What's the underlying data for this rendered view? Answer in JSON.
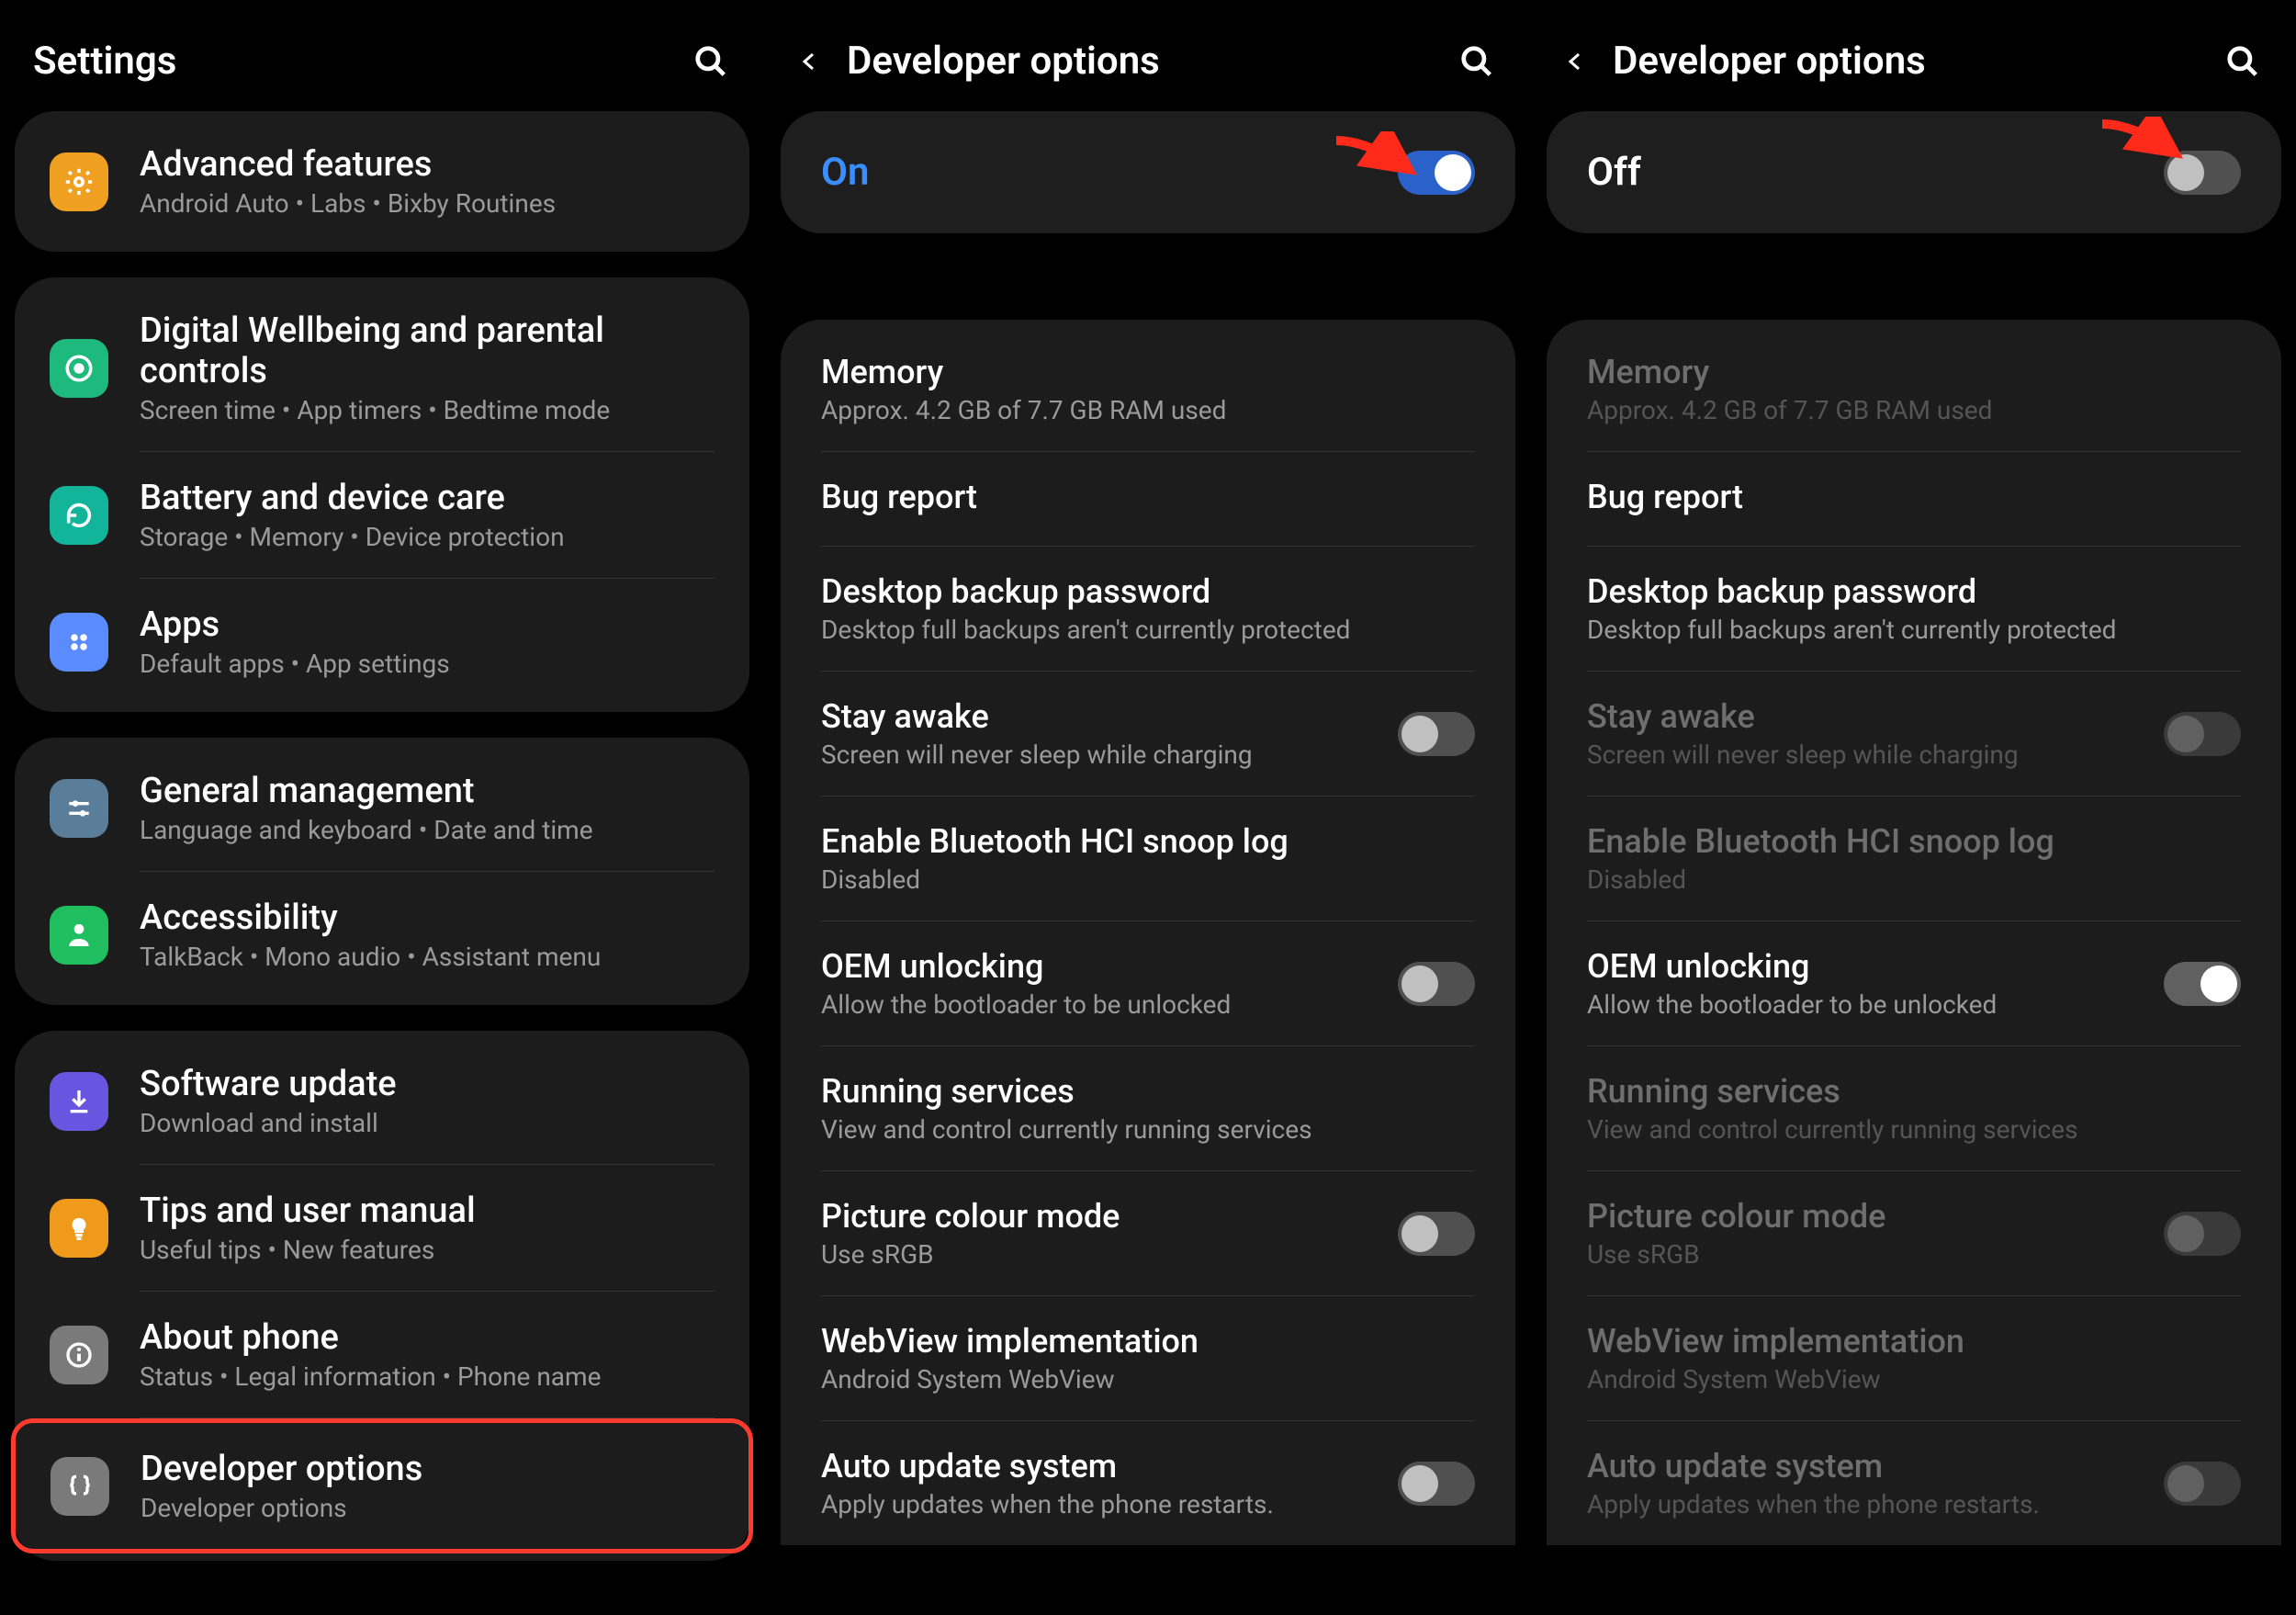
{
  "panel1": {
    "title": "Settings",
    "groups": [
      {
        "items": [
          {
            "iconColor": "#f0a020",
            "glyph": "gear",
            "primary": "Advanced features",
            "secondary": "Android Auto  •  Labs  •  Bixby Routines"
          }
        ]
      },
      {
        "items": [
          {
            "iconColor": "#1db97d",
            "glyph": "circle-target",
            "primary": "Digital Wellbeing and parental controls",
            "secondary": "Screen time  •  App timers  •  Bedtime mode"
          },
          {
            "iconColor": "#12b59a",
            "glyph": "refresh",
            "primary": "Battery and device care",
            "secondary": "Storage  •  Memory  •  Device protection"
          },
          {
            "iconColor": "#5a8cff",
            "glyph": "grid4",
            "primary": "Apps",
            "secondary": "Default apps  •  App settings"
          }
        ]
      },
      {
        "items": [
          {
            "iconColor": "#5a7d9a",
            "glyph": "sliders",
            "primary": "General management",
            "secondary": "Language and keyboard  •  Date and time"
          },
          {
            "iconColor": "#1fbf5f",
            "glyph": "person",
            "primary": "Accessibility",
            "secondary": "TalkBack  •  Mono audio  •  Assistant menu"
          }
        ]
      },
      {
        "items": [
          {
            "iconColor": "#6a55e0",
            "glyph": "download",
            "primary": "Software update",
            "secondary": "Download and install"
          },
          {
            "iconColor": "#f09a1c",
            "glyph": "bulb",
            "primary": "Tips and user manual",
            "secondary": "Useful tips  •  New features"
          },
          {
            "iconColor": "#7a7a7a",
            "glyph": "info",
            "primary": "About phone",
            "secondary": "Status  •  Legal information  •  Phone name"
          },
          {
            "iconColor": "#7a7a7a",
            "glyph": "braces",
            "primary": "Developer options",
            "secondary": "Developer options",
            "highlight": true
          }
        ]
      }
    ]
  },
  "panel2": {
    "title": "Developer options",
    "master": {
      "label": "On",
      "state": "on"
    },
    "items": [
      {
        "primary": "Memory",
        "secondary": "Approx. 4.2 GB of 7.7 GB RAM used"
      },
      {
        "primary": "Bug report"
      },
      {
        "primary": "Desktop backup password",
        "secondary": "Desktop full backups aren't currently protected"
      },
      {
        "primary": "Stay awake",
        "secondary": "Screen will never sleep while charging",
        "switch": "off"
      },
      {
        "primary": "Enable Bluetooth HCI snoop log",
        "secondary": "Disabled"
      },
      {
        "primary": "OEM unlocking",
        "secondary": "Allow the bootloader to be unlocked",
        "switch": "off"
      },
      {
        "primary": "Running services",
        "secondary": "View and control currently running services"
      },
      {
        "primary": "Picture colour mode",
        "secondary": "Use sRGB",
        "switch": "off"
      },
      {
        "primary": "WebView implementation",
        "secondary": "Android System WebView"
      },
      {
        "primary": "Auto update system",
        "secondary": "Apply updates when the phone restarts.",
        "switch": "off-peek"
      }
    ]
  },
  "panel3": {
    "title": "Developer options",
    "master": {
      "label": "Off",
      "state": "off"
    },
    "items": [
      {
        "primary": "Memory",
        "secondary": "Approx. 4.2 GB of 7.7 GB RAM used",
        "disabled": true
      },
      {
        "primary": "Bug report"
      },
      {
        "primary": "Desktop backup password",
        "secondary": "Desktop full backups aren't currently protected"
      },
      {
        "primary": "Stay awake",
        "secondary": "Screen will never sleep while charging",
        "switch": "dim",
        "disabled": true
      },
      {
        "primary": "Enable Bluetooth HCI snoop log",
        "secondary": "Disabled",
        "disabled": true
      },
      {
        "primary": "OEM unlocking",
        "secondary": "Allow the bootloader to be unlocked",
        "switch": "white-on"
      },
      {
        "primary": "Running services",
        "secondary": "View and control currently running services",
        "disabled": true
      },
      {
        "primary": "Picture colour mode",
        "secondary": "Use sRGB",
        "switch": "dim",
        "disabled": true
      },
      {
        "primary": "WebView implementation",
        "secondary": "Android System WebView",
        "disabled": true
      },
      {
        "primary": "Auto update system",
        "secondary": "Apply updates when the phone restarts.",
        "switch": "dim-peek",
        "disabled": true
      }
    ]
  }
}
